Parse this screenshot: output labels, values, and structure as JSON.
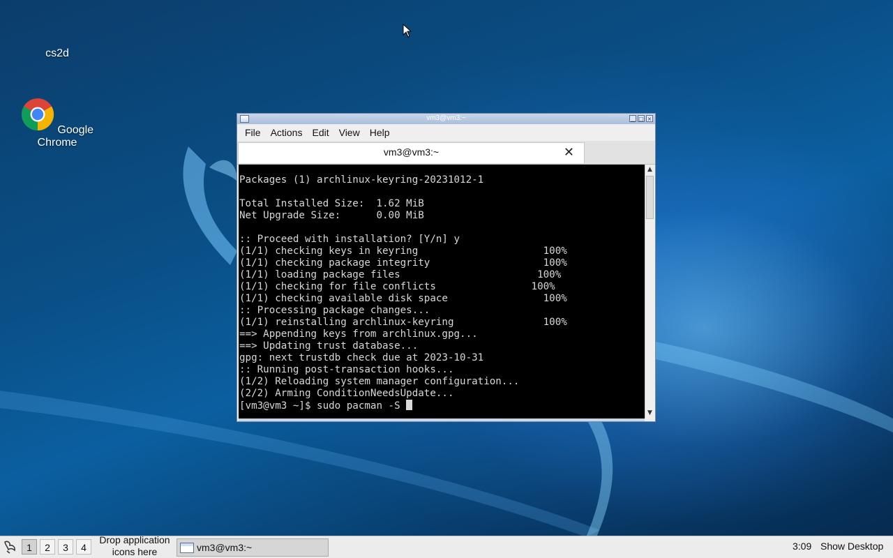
{
  "desktop": {
    "icons": [
      {
        "label": "cs2d"
      },
      {
        "label": "Google Chrome"
      }
    ]
  },
  "window": {
    "title": "vm3@vm3:~",
    "controls": {
      "minimize": "▁",
      "maximize": "□",
      "close": "×"
    },
    "menu": [
      "File",
      "Actions",
      "Edit",
      "View",
      "Help"
    ],
    "tab": {
      "label": "vm3@vm3:~",
      "close": "✕"
    },
    "terminal": {
      "lines": [
        "Packages (1) archlinux-keyring-20231012-1",
        "",
        "Total Installed Size:  1.62 MiB",
        "Net Upgrade Size:      0.00 MiB",
        "",
        ":: Proceed with installation? [Y/n] y",
        "(1/1) checking keys in keyring                     100%",
        "(1/1) checking package integrity                   100%",
        "(1/1) loading package files                       100%",
        "(1/1) checking for file conflicts                100%",
        "(1/1) checking available disk space                100%",
        ":: Processing package changes...",
        "(1/1) reinstalling archlinux-keyring               100%",
        "==> Appending keys from archlinux.gpg...",
        "==> Updating trust database...",
        "gpg: next trustdb check due at 2023-10-31",
        ":: Running post-transaction hooks...",
        "(1/2) Reloading system manager configuration...",
        "(2/2) Arming ConditionNeedsUpdate..."
      ],
      "prompt": "[vm3@vm3 ~]$ sudo pacman -S "
    }
  },
  "taskbar": {
    "workspaces": [
      "1",
      "2",
      "3",
      "4"
    ],
    "active_workspace": "1",
    "drop_hint_line1": "Drop application",
    "drop_hint_line2": "icons here",
    "task_item": "vm3@vm3:~",
    "clock": "3:09",
    "show_desktop": "Show Desktop"
  }
}
